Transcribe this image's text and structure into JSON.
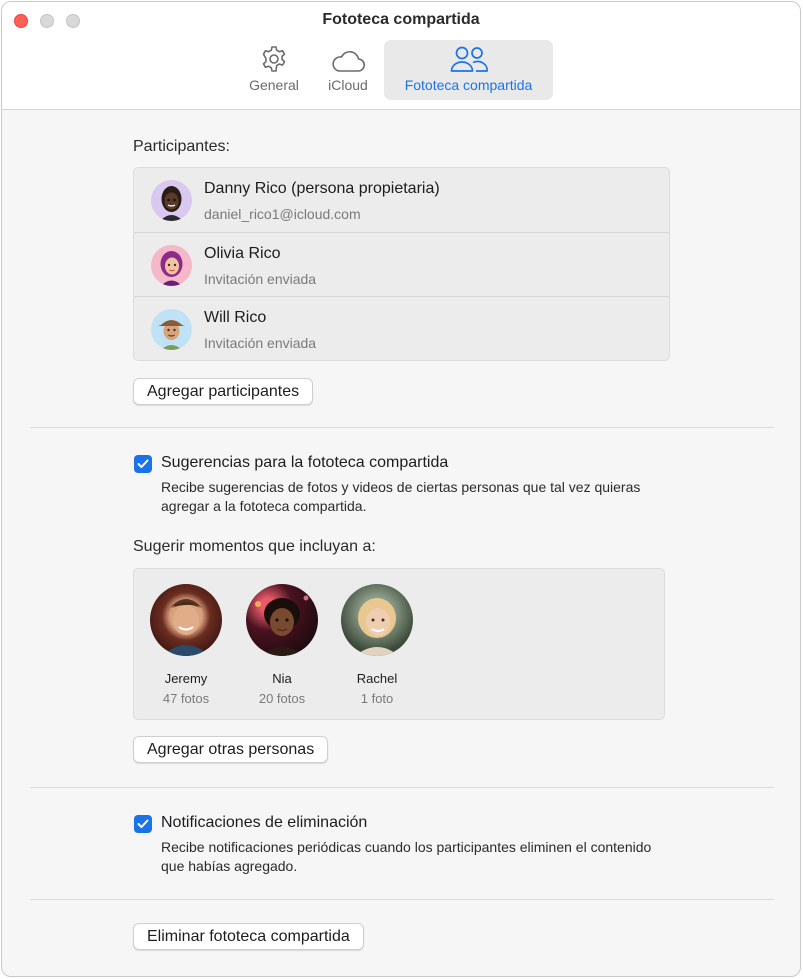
{
  "window": {
    "title": "Fototeca compartida"
  },
  "tabs": [
    {
      "label": "General",
      "icon": "gear-icon"
    },
    {
      "label": "iCloud",
      "icon": "cloud-icon"
    },
    {
      "label": "Fototeca compartida",
      "icon": "people-icon",
      "selected": true
    }
  ],
  "participants": {
    "heading": "Participantes:",
    "list": [
      {
        "name": "Danny Rico (persona propietaria)",
        "detail": "daniel_rico1@icloud.com",
        "avatar_bg": "#d9c8f0"
      },
      {
        "name": "Olivia Rico",
        "detail": "Invitación enviada",
        "avatar_bg": "#f5b8c8"
      },
      {
        "name": "Will Rico",
        "detail": "Invitación enviada",
        "avatar_bg": "#bfe3f5"
      }
    ],
    "add_button": "Agregar participantes"
  },
  "suggestions": {
    "checked": true,
    "label": "Sugerencias para la fototeca compartida",
    "description": "Recibe sugerencias de fotos y videos de ciertas personas que tal vez quieras agregar a la fototeca compartida."
  },
  "moments": {
    "heading": "Sugerir momentos que incluyan a:",
    "people": [
      {
        "name": "Jeremy",
        "count": "47 fotos"
      },
      {
        "name": "Nia",
        "count": "20 fotos"
      },
      {
        "name": "Rachel",
        "count": "1 foto"
      }
    ],
    "add_button": "Agregar otras personas"
  },
  "deletion": {
    "checked": true,
    "label": "Notificaciones de eliminación",
    "description": "Recibe notificaciones periódicas cuando los participantes eliminen el contenido que habías agregado."
  },
  "delete_button": "Eliminar fototeca compartida",
  "colors": {
    "accent": "#1a73e8",
    "close": "#ff5f57"
  }
}
